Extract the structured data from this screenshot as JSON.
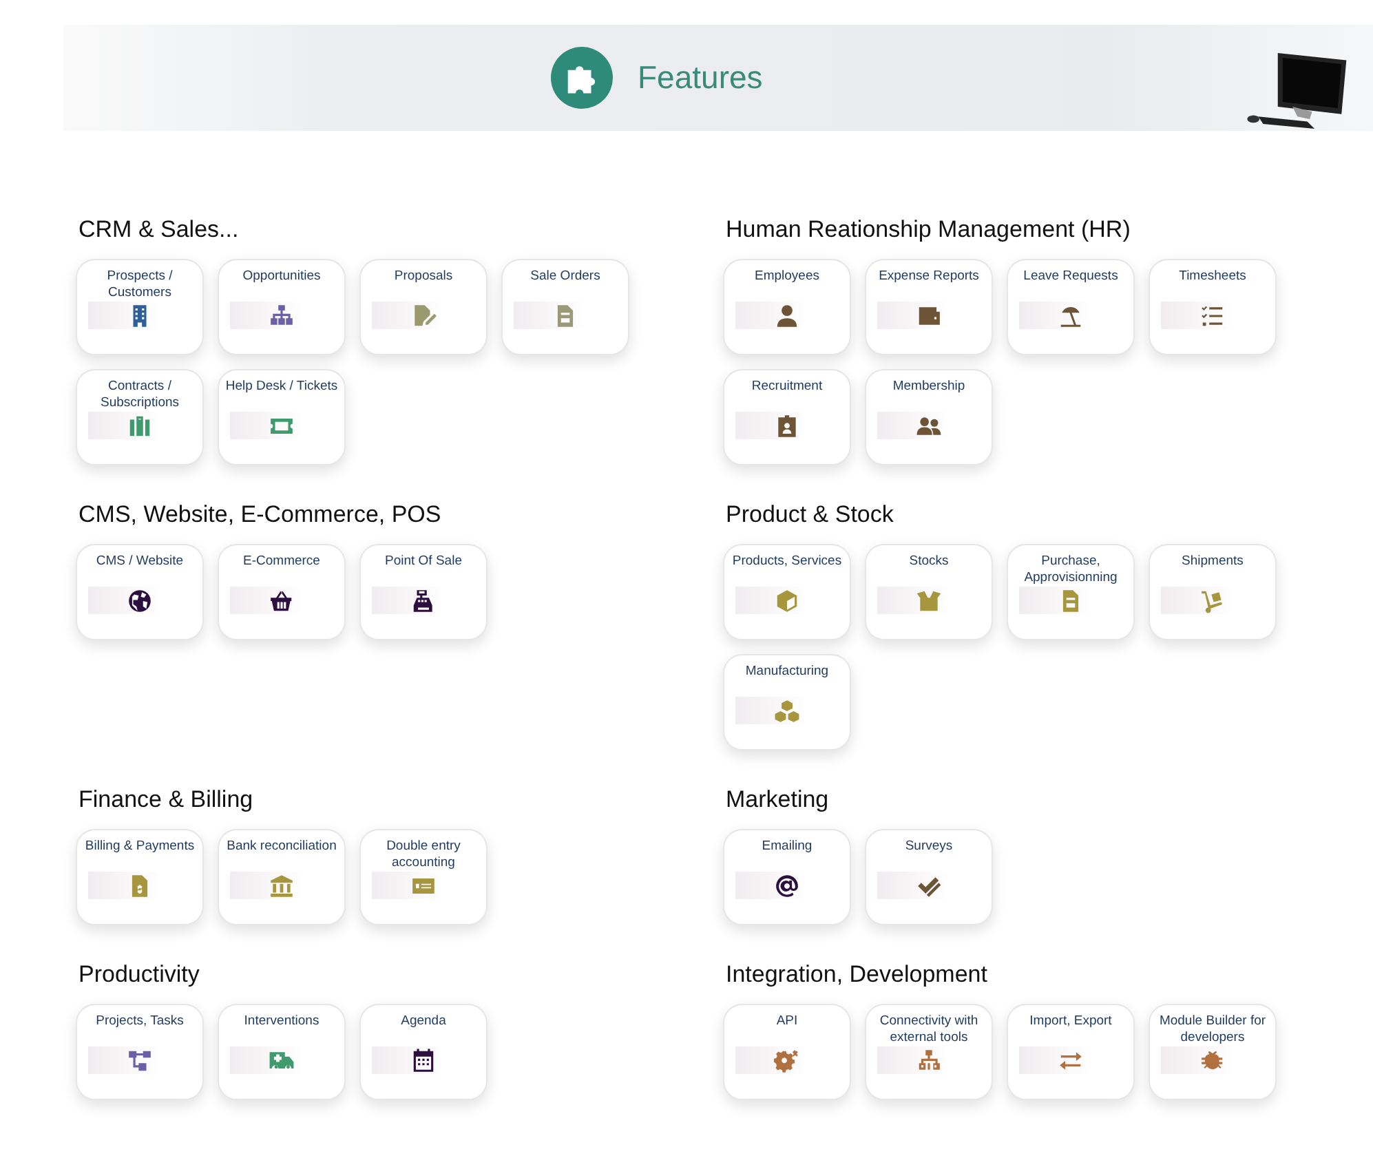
{
  "header": {
    "title": "Features"
  },
  "sections": [
    {
      "title": "CRM & Sales...",
      "cards": [
        {
          "label": "Prospects / Customers",
          "color": "#2d5f9a"
        },
        {
          "label": "Opportunities",
          "color": "#6b5fa8"
        },
        {
          "label": "Proposals",
          "color": "#9a9a6e"
        },
        {
          "label": "Sale Orders",
          "color": "#9a9a78"
        },
        {
          "label": "Contracts / Subscriptions",
          "color": "#3f9a6e"
        },
        {
          "label": "Help Desk / Tickets",
          "color": "#3f9a6e"
        }
      ]
    },
    {
      "title": "Human Reationship Management (HR)",
      "cards": [
        {
          "label": "Employees",
          "color": "#6e5436"
        },
        {
          "label": "Expense Reports",
          "color": "#6e5436"
        },
        {
          "label": "Leave Requests",
          "color": "#6e5436"
        },
        {
          "label": "Timesheets",
          "color": "#6e5436"
        },
        {
          "label": "Recruitment",
          "color": "#6e5436"
        },
        {
          "label": "Membership",
          "color": "#6e5436"
        }
      ]
    },
    {
      "title": "CMS, Website, E-Commerce, POS",
      "cards": [
        {
          "label": "CMS / Website",
          "color": "#2d0f3f"
        },
        {
          "label": "E-Commerce",
          "color": "#2d0f3f"
        },
        {
          "label": "Point Of Sale",
          "color": "#2d0f3f"
        }
      ]
    },
    {
      "title": "Product & Stock",
      "cards": [
        {
          "label": "Products, Services",
          "color": "#a8963f"
        },
        {
          "label": "Stocks",
          "color": "#a8963f"
        },
        {
          "label": "Purchase, Approvisionning",
          "color": "#a8963f"
        },
        {
          "label": "Shipments",
          "color": "#a8963f"
        },
        {
          "label": "Manufacturing",
          "color": "#a8963f"
        }
      ]
    },
    {
      "title": "Finance & Billing",
      "cards": [
        {
          "label": "Billing & Payments",
          "color": "#a8963f"
        },
        {
          "label": "Bank reconciliation",
          "color": "#a8963f"
        },
        {
          "label": "Double entry accounting",
          "color": "#a8963f"
        }
      ]
    },
    {
      "title": "Marketing",
      "cards": [
        {
          "label": "Emailing",
          "color": "#2d0f3f"
        },
        {
          "label": "Surveys",
          "color": "#6e5436"
        }
      ]
    },
    {
      "title": "Productivity",
      "cards": [
        {
          "label": "Projects, Tasks",
          "color": "#6b5fa8"
        },
        {
          "label": "Interventions",
          "color": "#3f9a6e"
        },
        {
          "label": "Agenda",
          "color": "#2d0f3f"
        }
      ]
    },
    {
      "title": "Integration, Development",
      "cards": [
        {
          "label": "API",
          "color": "#b0703f"
        },
        {
          "label": "Connectivity with external tools",
          "color": "#b0703f"
        },
        {
          "label": "Import, Export",
          "color": "#b0703f"
        },
        {
          "label": "Module Builder for developers",
          "color": "#b0703f"
        }
      ]
    }
  ]
}
